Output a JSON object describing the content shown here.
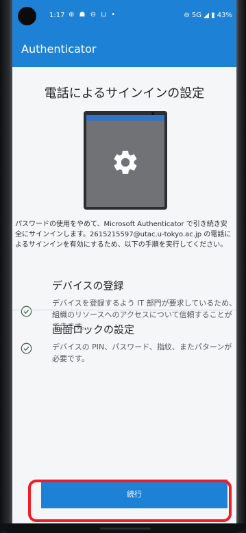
{
  "status_bar": {
    "time": "1:17",
    "left_icons": "⊕ ☗ ⊖ ⊔ •",
    "right_text": "⊖  5G ◢ ▮ 43%"
  },
  "app_bar": {
    "title": "Authenticator"
  },
  "main": {
    "page_title": "電話によるサインインの設定",
    "description": "パスワードの使用をやめて、Microsoft Authenticator で引き続き安全にサインインします。2615215597@utac.u-tokyo.ac.jp の電話によるサインインを有効にするため、以下の手順を実行してください。",
    "steps": [
      {
        "title": "デバイスの登録",
        "body": "デバイスを登録するよう IT 部門が要求しているため、組織のリソースへのアクセスについて信頼することができます。",
        "icon": "check-circle-icon"
      },
      {
        "title": "画面ロックの設定",
        "body": "デバイスの PIN、パスワード、指紋、またパターンが必要です。",
        "icon": "check-circle-icon"
      }
    ],
    "continue_label": "続行"
  },
  "colors": {
    "accent": "#1d82d6",
    "highlight": "#ef1d25"
  }
}
